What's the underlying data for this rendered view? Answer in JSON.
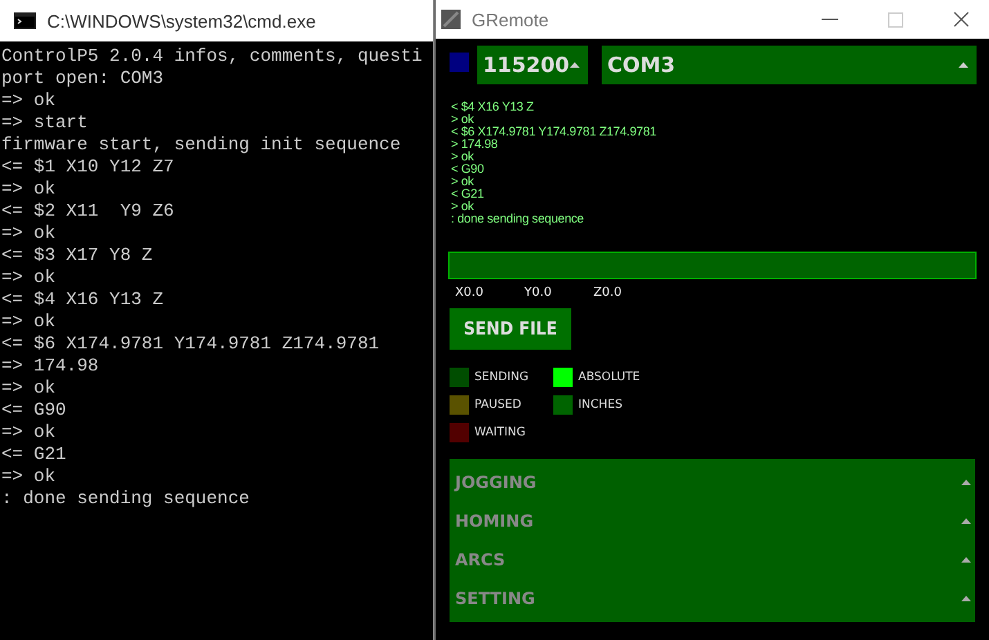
{
  "console_window": {
    "title": "C:\\WINDOWS\\system32\\cmd.exe",
    "lines": [
      "ControlP5 2.0.4 infos, comments, questi",
      "port open: COM3",
      "=> ok",
      "=> start",
      "firmware start, sending init sequence",
      "<= $1 X10 Y12 Z7",
      "=> ok",
      "<= $2 X11  Y9 Z6",
      "=> ok",
      "<= $3 X17 Y8 Z",
      "=> ok",
      "<= $4 X16 Y13 Z",
      "=> ok",
      "<= $6 X174.9781 Y174.9781 Z174.9781",
      "=> 174.98",
      "=> ok",
      "<= G90",
      "=> ok",
      "<= G21",
      "=> ok",
      ": done sending sequence"
    ]
  },
  "gremote_window": {
    "title": "GRemote",
    "baud_dropdown": {
      "value": "115200",
      "expanded": false
    },
    "port_dropdown": {
      "value": "COM3",
      "expanded": false
    },
    "log": [
      "< $4 X16 Y13 Z",
      "> ok",
      "< $6 X174.9781 Y174.9781 Z174.9781",
      "> 174.98",
      "> ok",
      "< G90",
      "> ok",
      "< G21",
      "> ok",
      ": done sending sequence"
    ],
    "coordinates": [
      "X0.0",
      "Y0.0",
      "Z0.0"
    ],
    "send_button": "SEND FILE",
    "status": [
      {
        "label": "SENDING",
        "color": "#004d00"
      },
      {
        "label": "ABSOLUTE",
        "color": "#00ff00"
      },
      {
        "label": "PAUSED",
        "color": "#5a5200"
      },
      {
        "label": "INCHES",
        "color": "#006400"
      },
      {
        "label": "WAITING",
        "color": "#520000"
      }
    ],
    "groups": [
      {
        "label": "JOGGING",
        "expanded": false
      },
      {
        "label": "HOMING",
        "expanded": false
      },
      {
        "label": "ARCS",
        "expanded": false
      },
      {
        "label": "SETTING",
        "expanded": false
      }
    ]
  }
}
